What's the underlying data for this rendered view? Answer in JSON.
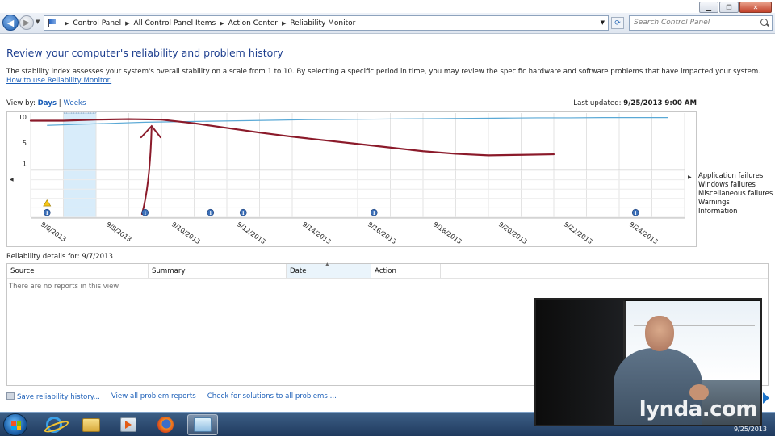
{
  "window": {
    "minimize_icon": "minimize-icon",
    "maximize_icon": "maximize-icon",
    "close_icon": "close-icon"
  },
  "address": {
    "crumbs": [
      "Control Panel",
      "All Control Panel Items",
      "Action Center",
      "Reliability Monitor"
    ],
    "search_placeholder": "Search Control Panel"
  },
  "page": {
    "title": "Review your computer's reliability and problem history",
    "description": "The stability index assesses your system's overall stability on a scale from 1 to 10. By selecting a specific period in time, you may review the specific hardware and software problems that have impacted your system.",
    "help_link": "How to use Reliability Monitor.",
    "view_by_label": "View by:",
    "view_days": "Days",
    "view_sep": "|",
    "view_weeks": "Weeks",
    "last_updated_label": "Last updated:",
    "last_updated_value": "9/25/2013 9:00 AM"
  },
  "chart_data": {
    "type": "line",
    "y_ticks": [
      "10",
      "5",
      "1"
    ],
    "ylim": [
      0,
      10
    ],
    "x_tick_labels": [
      "9/6/2013",
      "9/8/2013",
      "9/10/2013",
      "9/12/2013",
      "9/14/2013",
      "9/16/2013",
      "9/18/2013",
      "9/20/2013",
      "9/22/2013",
      "9/24/2013"
    ],
    "days": [
      "9/6",
      "9/7",
      "9/8",
      "9/9",
      "9/10",
      "9/11",
      "9/12",
      "9/13",
      "9/14",
      "9/15",
      "9/16",
      "9/17",
      "9/18",
      "9/19",
      "9/20",
      "9/21",
      "9/22",
      "9/23",
      "9/24",
      "9/25"
    ],
    "selected_day": "9/7",
    "series": [
      {
        "color": "#5aa9d6",
        "values": [
          8.4,
          8.6,
          8.8,
          9.0,
          9.1,
          9.2,
          9.3,
          9.4,
          9.5,
          9.55,
          9.6,
          9.65,
          9.7,
          9.75,
          9.8,
          9.85,
          9.85,
          9.9,
          9.9,
          9.9
        ]
      }
    ],
    "annotation_stroke": {
      "color": "#8b1a2a",
      "points": [
        [
          0,
          9.3
        ],
        [
          1,
          9.3
        ],
        [
          2,
          9.5
        ],
        [
          3,
          9.6
        ],
        [
          4,
          9.5
        ],
        [
          5,
          8.8
        ],
        [
          6,
          7.9
        ],
        [
          7,
          7.0
        ],
        [
          8,
          6.2
        ],
        [
          9,
          5.5
        ],
        [
          10,
          4.8
        ],
        [
          11,
          4.1
        ],
        [
          12,
          3.4
        ],
        [
          13,
          2.9
        ],
        [
          14,
          2.6
        ],
        [
          15,
          2.7
        ],
        [
          16,
          2.8
        ]
      ]
    },
    "events": {
      "rows": [
        "Application failures",
        "Windows failures",
        "Miscellaneous failures",
        "Warnings",
        "Information"
      ],
      "warnings": [
        "9/6"
      ],
      "information": [
        "9/6",
        "9/9",
        "9/11",
        "9/12",
        "9/16",
        "9/24"
      ]
    }
  },
  "details": {
    "title_label": "Reliability details for:",
    "title_date": "9/7/2013",
    "columns": [
      "Source",
      "Summary",
      "Date",
      "Action"
    ],
    "empty_text": "There are no reports in this view."
  },
  "footer": {
    "save": "Save reliability history...",
    "view_all": "View all problem reports",
    "check": "Check for solutions to all problems ..."
  },
  "taskbar": {
    "clock_date": "9/25/2013",
    "items": [
      "internet-explorer-icon",
      "folder-icon",
      "media-player-icon",
      "firefox-icon",
      "control-panel-icon"
    ]
  },
  "video": {
    "watermark": "lynda.com"
  }
}
